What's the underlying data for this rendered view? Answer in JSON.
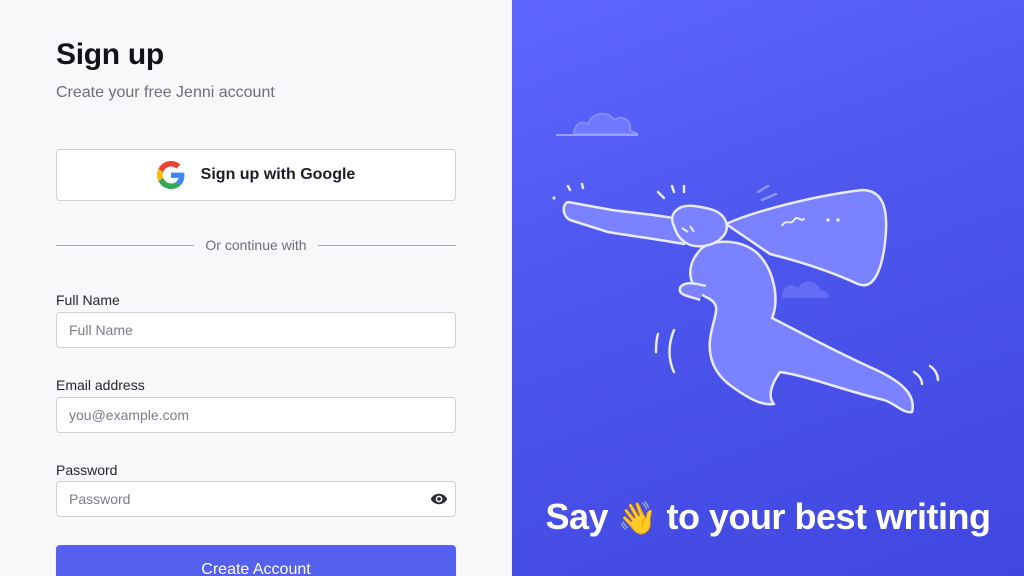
{
  "signup": {
    "title": "Sign up",
    "subtitle": "Create your free Jenni account",
    "google_button": "Sign up with Google",
    "divider_text": "Or continue with",
    "full_name": {
      "label": "Full Name",
      "placeholder": "Full Name",
      "value": ""
    },
    "email": {
      "label": "Email address",
      "placeholder": "you@example.com",
      "value": ""
    },
    "password": {
      "label": "Password",
      "placeholder": "Password",
      "value": ""
    },
    "submit_button": "Create Account"
  },
  "hero": {
    "tagline_before": "Say",
    "wave_emoji": "👋",
    "tagline_after": "to your best writing",
    "illustration_icon": "flying-superhero-illustration"
  },
  "colors": {
    "primary": "#5560ec",
    "hero_background": "#4c55ec"
  }
}
